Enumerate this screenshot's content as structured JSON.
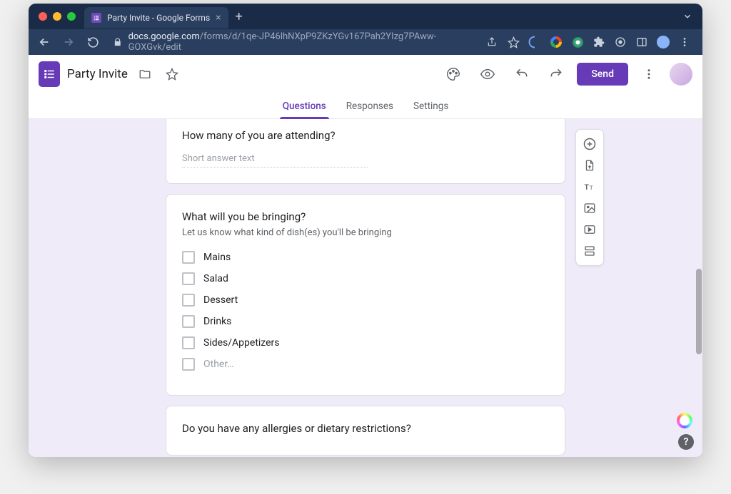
{
  "browser": {
    "tab_title": "Party Invite - Google Forms",
    "url_host": "docs.google.com",
    "url_path": "/forms/d/1qe-JP46lhNXpP9ZKzYGv167Pah2YIzg7PAww-GOXGvk/edit"
  },
  "header": {
    "doc_title": "Party Invite",
    "send_label": "Send"
  },
  "tabs": {
    "questions": "Questions",
    "responses": "Responses",
    "settings": "Settings"
  },
  "questions": {
    "q1": {
      "title": "How many of you are attending?",
      "hint": "Short answer text"
    },
    "q2": {
      "title": "What will you be bringing?",
      "description": "Let us know what kind of dish(es) you'll be bringing",
      "options": [
        "Mains",
        "Salad",
        "Dessert",
        "Drinks",
        "Sides/Appetizers"
      ],
      "other_label": "Other…"
    },
    "q3": {
      "title": "Do you have any allergies or dietary restrictions?"
    }
  },
  "float_toolbar": {
    "add_question": "add-question",
    "import_questions": "import-questions",
    "add_title": "add-title-desc",
    "add_image": "add-image",
    "add_video": "add-video",
    "add_section": "add-section"
  }
}
